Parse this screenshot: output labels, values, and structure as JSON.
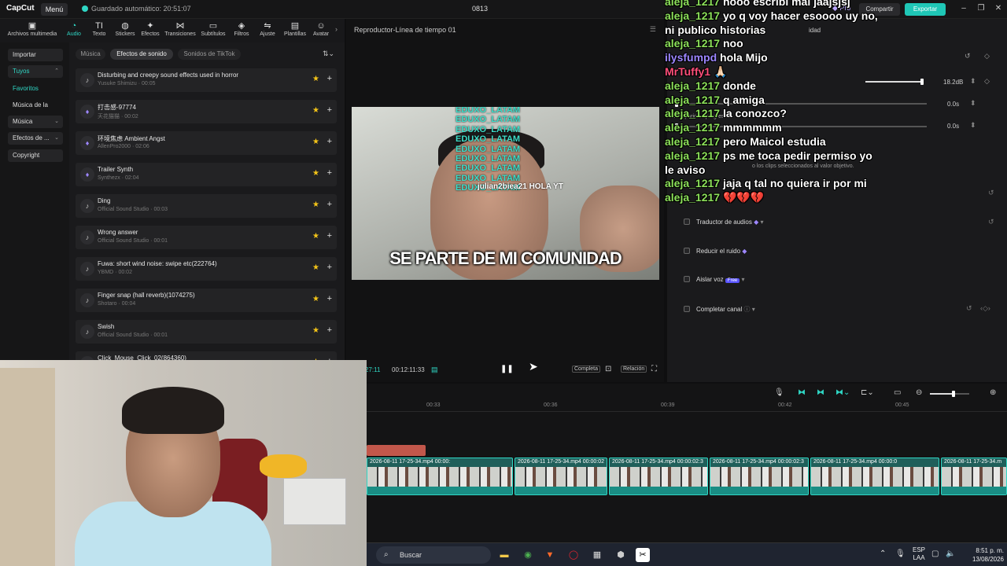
{
  "titlebar": {
    "app_name": "CapCut",
    "menu_label": "Menú",
    "autosave": "Guardado automático: 20:51:07",
    "project_name": "0813",
    "pro_label": "Pro",
    "share_label": "Compartir",
    "export_label": "Exportar"
  },
  "toolbar": {
    "tools": [
      {
        "label": "Archivos multimedia",
        "icon": "media-icon"
      },
      {
        "label": "Audio",
        "icon": "audio-icon",
        "active": true
      },
      {
        "label": "Texto",
        "icon": "text-icon"
      },
      {
        "label": "Stickers",
        "icon": "sticker-icon"
      },
      {
        "label": "Efectos",
        "icon": "effects-icon"
      },
      {
        "label": "Transiciones",
        "icon": "transitions-icon"
      },
      {
        "label": "Subtítulos",
        "icon": "subtitles-icon"
      },
      {
        "label": "Filtros",
        "icon": "filters-icon"
      },
      {
        "label": "Ajuste",
        "icon": "adjust-icon"
      },
      {
        "label": "Plantillas",
        "icon": "templates-icon"
      },
      {
        "label": "Avatar",
        "icon": "avatar-icon"
      }
    ]
  },
  "leftnav": {
    "items": [
      {
        "label": "Importar",
        "style": "box"
      },
      {
        "label": "Tuyos",
        "style": "box-sel",
        "chevron": "⌃"
      },
      {
        "label": "Favoritos",
        "style": "sel"
      },
      {
        "label": "Música de la ma...",
        "style": "plain"
      },
      {
        "label": "Música",
        "style": "box",
        "chevron": "⌄"
      },
      {
        "label": "Efectos de ...",
        "style": "box",
        "chevron": "⌄"
      },
      {
        "label": "Copyright",
        "style": "box"
      }
    ]
  },
  "library": {
    "tabs": [
      "Música",
      "Efectos de sonido",
      "Sonidos de TikTok"
    ],
    "active_tab": "Efectos de sonido",
    "sounds": [
      {
        "name": "Disturbing and creepy sound effects used in horror",
        "meta": "Yusuke Shimizu · 00:05",
        "gem": false
      },
      {
        "name": "打击感-97774",
        "meta": "天花猫猫 · 00:02",
        "gem": true
      },
      {
        "name": "环境焦虑  Ambient Angst",
        "meta": "AllenPro2000 · 02:06",
        "gem": true
      },
      {
        "name": "Trailer Synth",
        "meta": "Synthezx · 02:04",
        "gem": true
      },
      {
        "name": "Ding",
        "meta": "Official Sound Studio · 00:03",
        "gem": false
      },
      {
        "name": "Wrong answer",
        "meta": "Official Sound Studio · 00:01",
        "gem": false
      },
      {
        "name": "Fuwa: short wind noise: swipe etc(222764)",
        "meta": "YBMD · 00:02",
        "gem": false
      },
      {
        "name": "Finger snap (hall reverb)(1074275)",
        "meta": "Shotaro · 00:04",
        "gem": false
      },
      {
        "name": "Swish",
        "meta": "Official Sound Studio · 00:01",
        "gem": false
      },
      {
        "name": "Click_Mouse_Click_02(864360)",
        "meta": "",
        "gem": false
      }
    ]
  },
  "player": {
    "title": "Reproductor-Línea de tiempo 01",
    "caption": "SE PARTE DE MI COMUNIDAD",
    "overlay_lines": [
      "EDUXO_LATAM",
      "EDUXO_LATAM",
      "EDUXO_LATAM",
      "EDUXO_LATAM",
      "EDUXO_LATAM",
      "EDUXO_LATAM",
      "EDUXO_LATAM",
      "EDUXO_LATAM",
      "EDUXO_LATAM"
    ],
    "overlay_user": "julian2biea21 HOLA YT",
    "time_current": "27:11",
    "time_total": "00:12:11:33",
    "btn_full": "Completa",
    "btn_ratio": "Relación"
  },
  "rightpanel": {
    "tab_fragment": "idad",
    "volume_value": "18.2dB",
    "fade_in_value": "0.0s",
    "fade_out_value": "0.0s",
    "fade_out_label": "Desaparición progresiva",
    "normalize_desc": "o los clips seleccionados al valor objetivo.",
    "options": [
      {
        "label": "Traductor de audios",
        "gem": true
      },
      {
        "label": "Reducir el ruido",
        "gem": true
      },
      {
        "label": "Aislar voz",
        "badge": "Free"
      },
      {
        "label": "Completar canal",
        "gem": false
      }
    ]
  },
  "chat": {
    "lines": [
      {
        "user": "aleja_1217",
        "msg": "hooo escribi mal jaajsjsj",
        "color": "#8ce05a"
      },
      {
        "user": "aleja_1217",
        "msg": "yo q voy hacer esoooo uy no,",
        "color": "#8ce05a"
      },
      {
        "user": "",
        "msg": "ni publico historias",
        "color": "#8ce05a"
      },
      {
        "user": "aleja_1217",
        "msg": "noo",
        "color": "#8ce05a"
      },
      {
        "user": "ilysfumpd",
        "msg": "hola Mijo",
        "color": "#9c86ff"
      },
      {
        "user": "MrTuffy1",
        "msg": "🙏🏻",
        "color": "#ff4f7a"
      },
      {
        "user": "aleja_1217",
        "msg": "donde",
        "color": "#8ce05a"
      },
      {
        "user": "aleja_1217",
        "msg": "q amiga",
        "color": "#8ce05a"
      },
      {
        "user": "aleja_1217",
        "msg": "la conozco?",
        "color": "#8ce05a"
      },
      {
        "user": "aleja_1217",
        "msg": "mmmmmm",
        "color": "#8ce05a"
      },
      {
        "user": "aleja_1217",
        "msg": "pero Maicol estudia",
        "color": "#8ce05a"
      },
      {
        "user": "aleja_1217",
        "msg": "ps me toca pedir permiso yo",
        "color": "#8ce05a"
      },
      {
        "user": "",
        "msg": "le aviso",
        "color": "#8ce05a"
      },
      {
        "user": "aleja_1217",
        "msg": "jaja q tal no quiera ir por mi",
        "color": "#8ce05a"
      },
      {
        "user": "aleja_1217",
        "msg": "💔💔💔",
        "color": "#8ce05a"
      }
    ]
  },
  "timeline": {
    "ticks": [
      "00:33",
      "00:36",
      "00:39",
      "00:42",
      "00:45"
    ],
    "clips": [
      {
        "name": "2026-08-11 17-25-34.mp4  00:00:"
      },
      {
        "name": "2026-08-11 17-25-34.mp4  00:00:02"
      },
      {
        "name": "2026-08-11 17-25-34.mp4  00:00:02:3"
      },
      {
        "name": "2026-08-11 17-25-34.mp4  00:00:02:3"
      },
      {
        "name": "2026-08-11 17-25-34.mp4  00:00:0"
      },
      {
        "name": "2026-08-11 17-25-34.m"
      }
    ]
  },
  "taskbar": {
    "search_placeholder": "Buscar",
    "lang": "ESP",
    "region": "LAA",
    "time": "8:51 p. m.",
    "date": "13/08/2026"
  }
}
